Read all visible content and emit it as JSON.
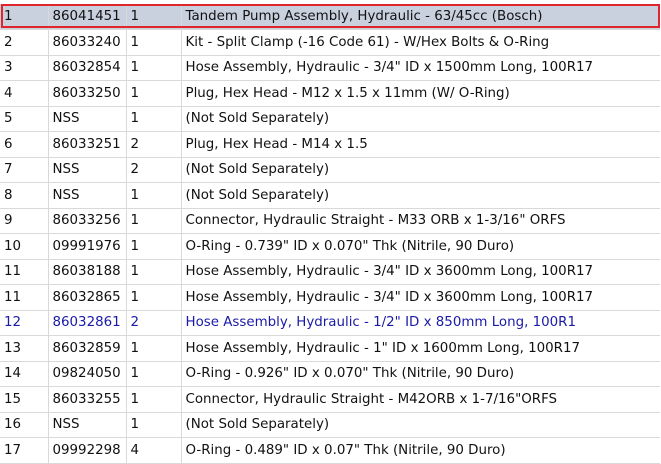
{
  "rows": [
    {
      "item": "1",
      "part": "86041451",
      "qty": "1",
      "desc": "Tandem Pump Assembly, Hydraulic - 63/45cc (Bosch)"
    },
    {
      "item": "2",
      "part": "86033240",
      "qty": "1",
      "desc": "Kit - Split Clamp (-16 Code 61) - W/Hex Bolts & O-Ring"
    },
    {
      "item": "3",
      "part": "86032854",
      "qty": "1",
      "desc": "Hose Assembly, Hydraulic - 3/4\" ID x 1500mm Long, 100R17"
    },
    {
      "item": "4",
      "part": "86033250",
      "qty": "1",
      "desc": "Plug, Hex Head - M12 x 1.5 x 11mm (W/ O-Ring)"
    },
    {
      "item": "5",
      "part": "NSS",
      "qty": "1",
      "desc": "(Not Sold Separately)"
    },
    {
      "item": "6",
      "part": "86033251",
      "qty": "2",
      "desc": "Plug, Hex Head - M14 x 1.5"
    },
    {
      "item": "7",
      "part": "NSS",
      "qty": "2",
      "desc": "(Not Sold Separately)"
    },
    {
      "item": "8",
      "part": "NSS",
      "qty": "1",
      "desc": "(Not Sold Separately)"
    },
    {
      "item": "9",
      "part": "86033256",
      "qty": "1",
      "desc": "Connector, Hydraulic Straight - M33 ORB x 1-3/16\" ORFS"
    },
    {
      "item": "10",
      "part": "09991976",
      "qty": "1",
      "desc": "O-Ring - 0.739\" ID x 0.070\" Thk (Nitrile, 90 Duro)"
    },
    {
      "item": "11",
      "part": "86038188",
      "qty": "1",
      "desc": "Hose Assembly, Hydraulic - 3/4\" ID x 3600mm Long, 100R17"
    },
    {
      "item": "11",
      "part": "86032865",
      "qty": "1",
      "desc": "Hose Assembly, Hydraulic - 3/4\" ID x 3600mm Long, 100R17"
    },
    {
      "item": "12",
      "part": "86032861",
      "qty": "2",
      "desc": "Hose Assembly, Hydraulic - 1/2\" ID x 850mm Long, 100R1"
    },
    {
      "item": "13",
      "part": "86032859",
      "qty": "1",
      "desc": "Hose Assembly, Hydraulic - 1\" ID x 1600mm Long, 100R17"
    },
    {
      "item": "14",
      "part": "09824050",
      "qty": "1",
      "desc": "O-Ring - 0.926\" ID x 0.070\" Thk (Nitrile, 90 Duro)"
    },
    {
      "item": "15",
      "part": "86033255",
      "qty": "1",
      "desc": "Connector, Hydraulic Straight - M42ORB x 1-7/16\"ORFS"
    },
    {
      "item": "16",
      "part": "NSS",
      "qty": "1",
      "desc": "(Not Sold Separately)"
    },
    {
      "item": "17",
      "part": "09992298",
      "qty": "4",
      "desc": "O-Ring - 0.489\" ID x 0.07\" Thk (Nitrile, 90 Duro)"
    }
  ],
  "colors": {
    "selected_row_bg": "#c9d0de",
    "selected_frame": "#e0262c",
    "highlight_text": "#1a1aa8"
  }
}
